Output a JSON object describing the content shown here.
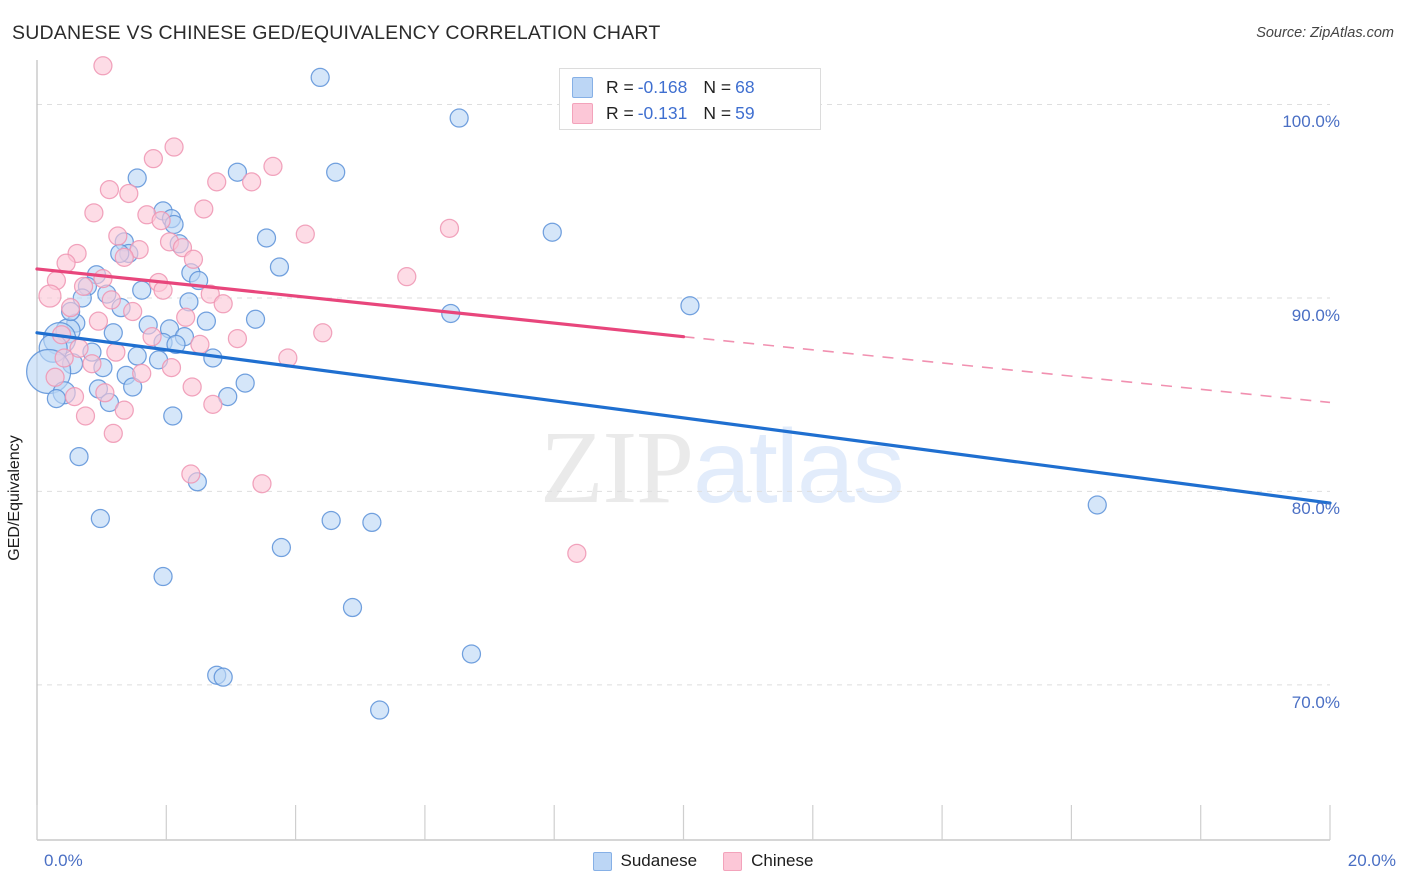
{
  "header": {
    "title": "SUDANESE VS CHINESE GED/EQUIVALENCY CORRELATION CHART",
    "source": "Source: ZipAtlas.com"
  },
  "watermark": {
    "part1": "ZIP",
    "part2": "atlas"
  },
  "legend": {
    "rows": [
      {
        "series": "Sudanese",
        "r_label": "R =",
        "r_value": "-0.168",
        "n_label": "N =",
        "n_value": "68",
        "color": "#bcd6f5",
        "border": "#86b0e6"
      },
      {
        "series": "Chinese",
        "r_label": "R =",
        "r_value": "-0.131",
        "n_label": "N =",
        "n_value": "59",
        "color": "#fcc7d7",
        "border": "#f3a3bb"
      }
    ]
  },
  "bottom_legend": [
    {
      "label": "Sudanese",
      "color": "#bcd6f5"
    },
    {
      "label": "Chinese",
      "color": "#fcc7d7"
    }
  ],
  "axes": {
    "ylabel": "GED/Equivalency",
    "yticks": [
      "100.0%",
      "90.0%",
      "80.0%",
      "70.0%"
    ],
    "xticks": [
      "0.0%",
      "20.0%"
    ]
  },
  "chart_data": {
    "type": "scatter",
    "title": "SUDANESE VS CHINESE GED/EQUIVALENCY CORRELATION CHART",
    "xlabel": "",
    "ylabel": "GED/Equivalency",
    "xlim": [
      0,
      20
    ],
    "ylim": [
      62.5,
      102.3
    ],
    "xtick_values": [
      0,
      20
    ],
    "xtick_labels": [
      "0.0%",
      "20.0%"
    ],
    "ytick_values": [
      100,
      90,
      80,
      70
    ],
    "ytick_labels": [
      "100.0%",
      "90.0%",
      "80.0%",
      "70.0%"
    ],
    "grid": "horizontal-dashed",
    "legend_position": "top-center-inside",
    "series": [
      {
        "name": "Sudanese",
        "color": "#bcd6f5",
        "border": "#5b91d8",
        "R": -0.168,
        "N": 68,
        "trend": {
          "x0": 0,
          "y0": 88.2,
          "x1": 20,
          "y1": 79.4,
          "style": "solid",
          "color": "#1f6fd0"
        },
        "points": [
          [
            4.38,
            101.4,
            9
          ],
          [
            6.53,
            99.3,
            9
          ],
          [
            4.62,
            96.5,
            9
          ],
          [
            3.1,
            96.5,
            9
          ],
          [
            1.55,
            96.2,
            9
          ],
          [
            1.95,
            94.5,
            9
          ],
          [
            2.08,
            94.1,
            9
          ],
          [
            2.12,
            93.8,
            9
          ],
          [
            7.97,
            93.4,
            9
          ],
          [
            3.55,
            93.1,
            9
          ],
          [
            1.35,
            92.9,
            9
          ],
          [
            2.2,
            92.8,
            9
          ],
          [
            1.42,
            92.3,
            9
          ],
          [
            1.28,
            92.3,
            9
          ],
          [
            3.75,
            91.6,
            9
          ],
          [
            2.38,
            91.3,
            9
          ],
          [
            0.92,
            91.2,
            9
          ],
          [
            2.5,
            90.9,
            9
          ],
          [
            0.78,
            90.6,
            9
          ],
          [
            1.62,
            90.4,
            9
          ],
          [
            1.08,
            90.2,
            9
          ],
          [
            0.7,
            90.0,
            9
          ],
          [
            10.1,
            89.6,
            9
          ],
          [
            6.4,
            89.2,
            9
          ],
          [
            3.38,
            88.9,
            9
          ],
          [
            2.62,
            88.8,
            9
          ],
          [
            0.6,
            88.7,
            9
          ],
          [
            1.72,
            88.6,
            9
          ],
          [
            2.05,
            88.4,
            9
          ],
          [
            0.48,
            88.3,
            12
          ],
          [
            1.18,
            88.2,
            9
          ],
          [
            2.28,
            88.0,
            9
          ],
          [
            0.35,
            87.9,
            16
          ],
          [
            1.95,
            87.7,
            9
          ],
          [
            2.15,
            87.6,
            9
          ],
          [
            0.25,
            87.4,
            14
          ],
          [
            0.85,
            87.2,
            9
          ],
          [
            1.55,
            87.0,
            9
          ],
          [
            2.72,
            86.9,
            9
          ],
          [
            0.55,
            86.6,
            10
          ],
          [
            1.02,
            86.4,
            9
          ],
          [
            0.18,
            86.2,
            22
          ],
          [
            1.38,
            86.0,
            9
          ],
          [
            3.22,
            85.6,
            9
          ],
          [
            1.48,
            85.4,
            9
          ],
          [
            0.95,
            85.3,
            9
          ],
          [
            0.42,
            85.1,
            11
          ],
          [
            2.95,
            84.9,
            9
          ],
          [
            2.1,
            83.9,
            9
          ],
          [
            0.65,
            81.8,
            9
          ],
          [
            2.48,
            80.5,
            9
          ],
          [
            0.98,
            78.6,
            9
          ],
          [
            4.55,
            78.5,
            9
          ],
          [
            5.18,
            78.4,
            9
          ],
          [
            3.78,
            77.1,
            9
          ],
          [
            1.95,
            75.6,
            9
          ],
          [
            4.88,
            74.0,
            9
          ],
          [
            6.72,
            71.6,
            9
          ],
          [
            2.78,
            70.5,
            9
          ],
          [
            2.88,
            70.4,
            9
          ],
          [
            16.4,
            79.3,
            9
          ],
          [
            5.3,
            68.7,
            9
          ],
          [
            1.3,
            89.5,
            9
          ],
          [
            2.35,
            89.8,
            9
          ],
          [
            0.52,
            89.3,
            9
          ],
          [
            1.88,
            86.8,
            9
          ],
          [
            0.3,
            84.8,
            9
          ],
          [
            1.12,
            84.6,
            9
          ]
        ]
      },
      {
        "name": "Chinese",
        "color": "#fcc7d7",
        "border": "#ef94b1",
        "R": -0.131,
        "N": 59,
        "trend": {
          "x0": 0,
          "y0": 91.5,
          "x1": 10.0,
          "y1": 88.0,
          "x2": 20,
          "y2": 84.6,
          "style": "solid-then-dashed",
          "color": "#e8467c"
        },
        "points": [
          [
            1.02,
            102.0,
            9
          ],
          [
            2.12,
            97.8,
            9
          ],
          [
            1.8,
            97.2,
            9
          ],
          [
            3.65,
            96.8,
            9
          ],
          [
            2.78,
            96.0,
            9
          ],
          [
            3.32,
            96.0,
            9
          ],
          [
            1.12,
            95.6,
            9
          ],
          [
            1.42,
            95.4,
            9
          ],
          [
            2.58,
            94.6,
            9
          ],
          [
            0.88,
            94.4,
            9
          ],
          [
            1.7,
            94.3,
            9
          ],
          [
            1.92,
            94.0,
            9
          ],
          [
            6.38,
            93.6,
            9
          ],
          [
            4.15,
            93.3,
            9
          ],
          [
            1.25,
            93.2,
            9
          ],
          [
            2.05,
            92.9,
            9
          ],
          [
            2.25,
            92.6,
            9
          ],
          [
            1.58,
            92.5,
            9
          ],
          [
            0.62,
            92.3,
            9
          ],
          [
            1.35,
            92.1,
            9
          ],
          [
            2.42,
            92.0,
            9
          ],
          [
            0.45,
            91.8,
            9
          ],
          [
            5.72,
            91.1,
            9
          ],
          [
            1.02,
            91.0,
            9
          ],
          [
            0.3,
            90.9,
            9
          ],
          [
            1.88,
            90.8,
            9
          ],
          [
            0.72,
            90.6,
            9
          ],
          [
            2.68,
            90.2,
            9
          ],
          [
            0.2,
            90.1,
            11
          ],
          [
            1.15,
            89.9,
            9
          ],
          [
            2.88,
            89.7,
            9
          ],
          [
            0.52,
            89.5,
            9
          ],
          [
            1.48,
            89.3,
            9
          ],
          [
            2.3,
            89.0,
            9
          ],
          [
            0.95,
            88.8,
            9
          ],
          [
            4.42,
            88.2,
            9
          ],
          [
            0.38,
            88.1,
            9
          ],
          [
            1.78,
            88.0,
            9
          ],
          [
            3.1,
            87.9,
            9
          ],
          [
            2.52,
            87.6,
            9
          ],
          [
            0.65,
            87.4,
            9
          ],
          [
            1.22,
            87.2,
            9
          ],
          [
            3.88,
            86.9,
            9
          ],
          [
            0.85,
            86.6,
            9
          ],
          [
            2.08,
            86.4,
            9
          ],
          [
            1.62,
            86.1,
            9
          ],
          [
            0.28,
            85.9,
            9
          ],
          [
            2.4,
            85.4,
            9
          ],
          [
            1.05,
            85.1,
            9
          ],
          [
            0.58,
            84.9,
            9
          ],
          [
            2.72,
            84.5,
            9
          ],
          [
            1.35,
            84.2,
            9
          ],
          [
            0.75,
            83.9,
            9
          ],
          [
            1.18,
            83.0,
            9
          ],
          [
            2.38,
            80.9,
            9
          ],
          [
            3.48,
            80.4,
            9
          ],
          [
            8.35,
            76.8,
            9
          ],
          [
            0.42,
            86.9,
            9
          ],
          [
            1.95,
            90.4,
            9
          ]
        ]
      }
    ]
  }
}
